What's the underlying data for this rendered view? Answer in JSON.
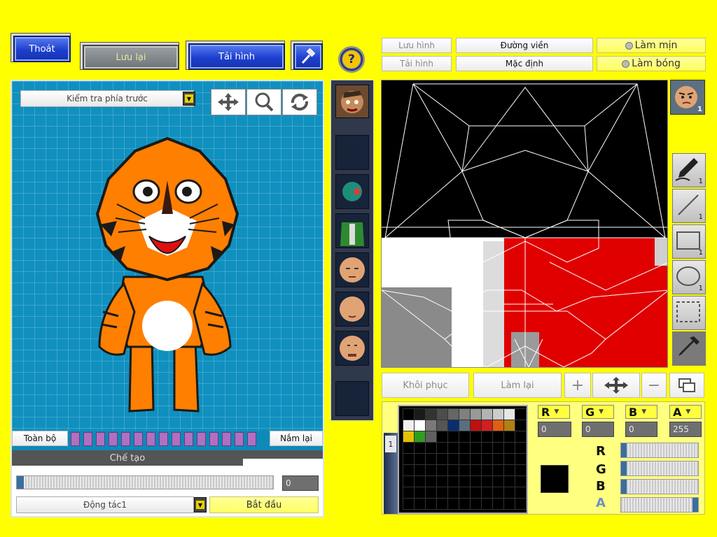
{
  "top_left": {
    "exit_label": "Thoát",
    "save_label": "Lưu lại",
    "load_label": "Tải hình",
    "tool_icon": "hammer-icon",
    "help_icon": "question-mark-icon"
  },
  "top_right": {
    "save_image": "Lưu hình",
    "load_image": "Tải hình",
    "outline": "Đường viền",
    "default": "Mặc định",
    "smooth": "Làm mịn",
    "shade": "Làm bóng"
  },
  "preview": {
    "view_select": "Kiểm tra phía trước",
    "view_icons": [
      "move-arrows-icon",
      "magnifier-icon",
      "rotate-icon"
    ],
    "all_label": "Toàn bộ",
    "grab_label": "Nắm lại",
    "frames_count": 15,
    "create_label": "Chế tạo",
    "progress_value": "0",
    "action_select": "Động tác1",
    "start_label": "Bắt đầu"
  },
  "editor": {
    "restore_label": "Khôi phục",
    "redo_label": "Làm lại",
    "avatar_badge": "1",
    "tools": [
      {
        "name": "pen-tool-icon",
        "badge": "1"
      },
      {
        "name": "line-tool-icon",
        "badge": "1"
      },
      {
        "name": "rectangle-tool-icon",
        "badge": "1"
      },
      {
        "name": "ellipse-tool-icon",
        "badge": "1"
      },
      {
        "name": "select-tool-icon",
        "badge": ""
      },
      {
        "name": "eyedropper-tool-icon",
        "badge": ""
      }
    ]
  },
  "color": {
    "r_label": "R",
    "g_label": "G",
    "b_label": "B",
    "a_label": "A",
    "r": "0",
    "g": "0",
    "b": "0",
    "a": "255",
    "palette_tab": "1",
    "selected_color": "#000000",
    "palette_row1": [
      "#000000",
      "#1a1a1a",
      "#333333",
      "#4d4d4d",
      "#666666",
      "#808080",
      "#999999",
      "#b3b3b3",
      "#cccccc",
      "#e6e6e6"
    ],
    "palette_row2": [
      "#f0f0f0",
      "#ffffff",
      "#7a7a7a",
      "#555555",
      "#0b2e6e",
      "#5a6e80",
      "#c01010",
      "#d02020",
      "#e06010",
      "#b08010"
    ],
    "palette_row3": [
      "#e6c000",
      "#2e9e1e",
      "#606060"
    ]
  }
}
